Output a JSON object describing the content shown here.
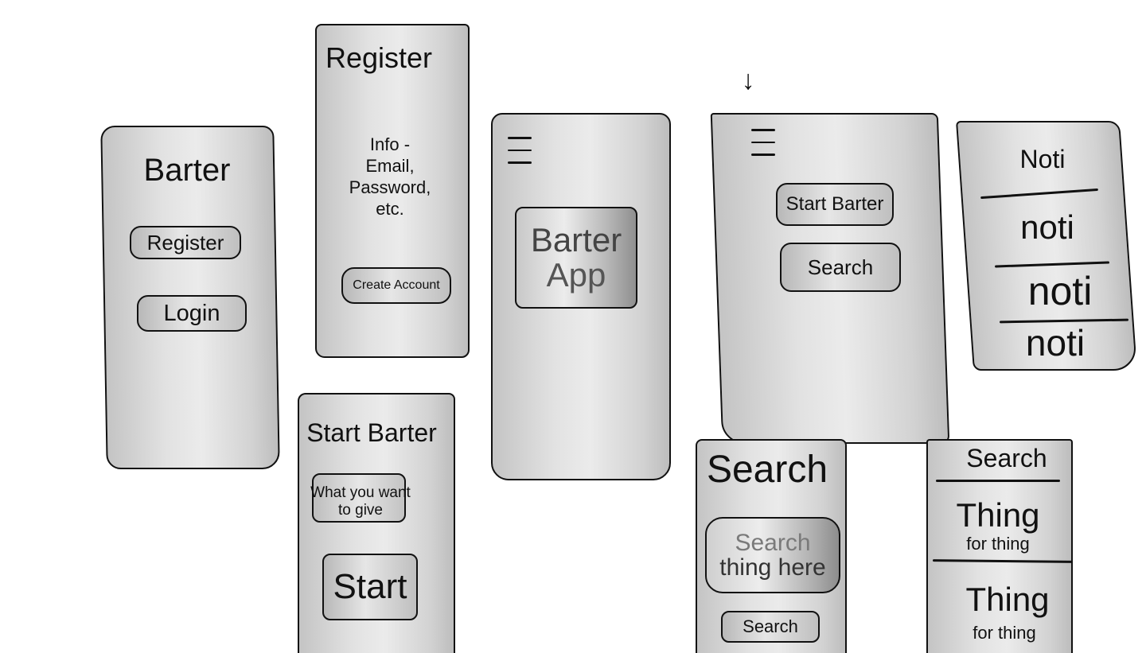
{
  "login_screen": {
    "title": "Barter",
    "register_label": "Register",
    "login_label": "Login"
  },
  "register_screen": {
    "title": "Register",
    "info_lines": [
      "Info -",
      "Email,",
      "Password,",
      "etc."
    ],
    "create_account_label": "Create Account"
  },
  "start_barter_screen": {
    "title": "Start Barter",
    "give_lines": [
      "What you want",
      "to give"
    ],
    "start_label": "Start"
  },
  "splash_screen": {
    "logo_lines": [
      "Barter",
      "App"
    ]
  },
  "menu_screen": {
    "arrow": "↓",
    "start_barter_label": "Start Barter",
    "search_label": "Search"
  },
  "notifications_screen": {
    "title": "Noti",
    "items": [
      "noti",
      "noti",
      "noti"
    ]
  },
  "search_screen": {
    "title": "Search",
    "field_lines": [
      "Search",
      "thing here"
    ],
    "search_button_label": "Search"
  },
  "results_screen": {
    "title": "Search",
    "items": [
      {
        "name": "Thing",
        "sub": "for thing"
      },
      {
        "name": "Thing",
        "sub": "for thing"
      }
    ]
  }
}
